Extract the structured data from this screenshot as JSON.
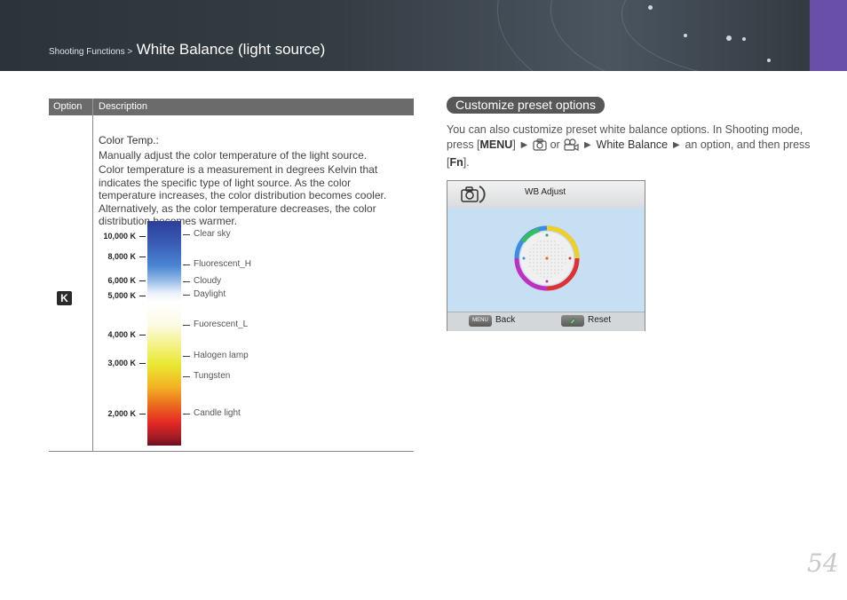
{
  "header": {
    "breadcrumb_section": "Shooting Functions >",
    "breadcrumb_title": "White Balance (light source)"
  },
  "table": {
    "col_option": "Option",
    "col_description": "Description",
    "option_icon_text": "K",
    "desc_title": "Color Temp.:",
    "desc_line1": "Manually adjust the color temperature of the light source.",
    "desc_para": "Color temperature is a measurement in degrees Kelvin that indicates the specific type of light source. As the color temperature increases, the color distribution becomes cooler. Alternatively, as the color temperature decreases, the color distribution becomes warmer.",
    "kelvin_labels": [
      "10,000 K",
      "8,000 K",
      "6,000 K",
      "5,000 K",
      "4,000 K",
      "3,000 K",
      "2,000 K"
    ],
    "light_sources": [
      "Clear sky",
      "Fluorescent_H",
      "Cloudy",
      "Daylight",
      "Fuorescent_L",
      "Halogen lamp",
      "Tungsten",
      "Candle light"
    ]
  },
  "section": {
    "title": "Customize preset options",
    "text1": "You can also customize preset white balance options. In Shooting mode, press [",
    "key_menu": "MENU",
    "text2": "] ► ",
    "text_or": " or ",
    "text3": " ► ",
    "item_wb": "White Balance",
    "text4": " ► an option, and then press [",
    "key_fn": "Fn",
    "text5": "]."
  },
  "screen": {
    "title": "WB Adjust",
    "menu_btn": "MENU",
    "back_label": "Back",
    "reset_label": "Reset"
  },
  "page_number": "54",
  "icons": [
    "camera-icon",
    "movie-camera-icon",
    "color-wheel-icon",
    "reset-icon"
  ]
}
